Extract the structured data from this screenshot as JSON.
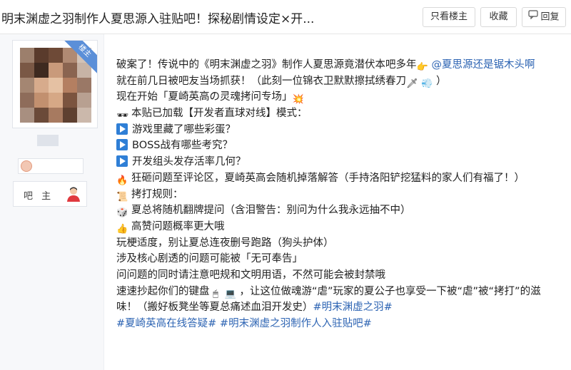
{
  "header": {
    "title": "明末渊虚之羽制作人夏思源入驻贴吧！探秘剧情设定×开...",
    "only_louzhu_label": "只看楼主",
    "favorite_label": "收藏",
    "reply_label": "回复"
  },
  "author": {
    "badge": "楼主",
    "louzhu_label": "吧 主"
  },
  "post": {
    "l1a": "破案了！传说中的《明末渊虚之羽》制作人夏思源竟潜伏本吧多年",
    "l1_mention": "@夏思源还是锯木头啊",
    "l2": "就在前几日被吧友当场抓获！（此刻一位锦衣卫默默擦拭绣春刀",
    "l2_end": "）",
    "l3": "现在开始「夏崎英高の灵魂拷问专场」",
    "l4": "本贴已加载【开发者直球对线】模式：",
    "l5": "游戏里藏了哪些彩蛋？",
    "l6": "BOSS战有哪些考究？",
    "l7": "开发组头发存活率几何？",
    "l8": "狂砸问题至评论区，夏崎英高会随机掉落解答（手持洛阳铲挖猛料的家人们有福了！）",
    "l9": "拷打规则：",
    "l10": "夏总将随机翻牌提问（含泪警告：别问为什么我永远抽不中）",
    "l11": "高赞问题概率更大哦",
    "l12": "玩梗适度，别让夏总连夜删号跑路（狗头护体）",
    "l13": "涉及核心剧透的问题可能被「无可奉告」",
    "l14": "问问题的同时请注意吧规和文明用语，不然可能会被封禁哦",
    "l15a": "速速抄起你们的键盘",
    "l15b": "，让这位做魂游“虐”玩家的夏公子也享受一下被“虐”被“拷打”的滋",
    "l16": "味！（搬好板凳坐等夏总痛述血泪开发史）",
    "l16_tag": "#明末渊虚之羽#",
    "l17_tag1": "#夏崎英高在线答疑#",
    "l17_tag2": "#明末渊虚之羽制作人入驻贴吧#"
  },
  "colors": {
    "link": "#2d64b3",
    "badge": "#5b8fd8",
    "play_icon": "#2f7fd6"
  }
}
